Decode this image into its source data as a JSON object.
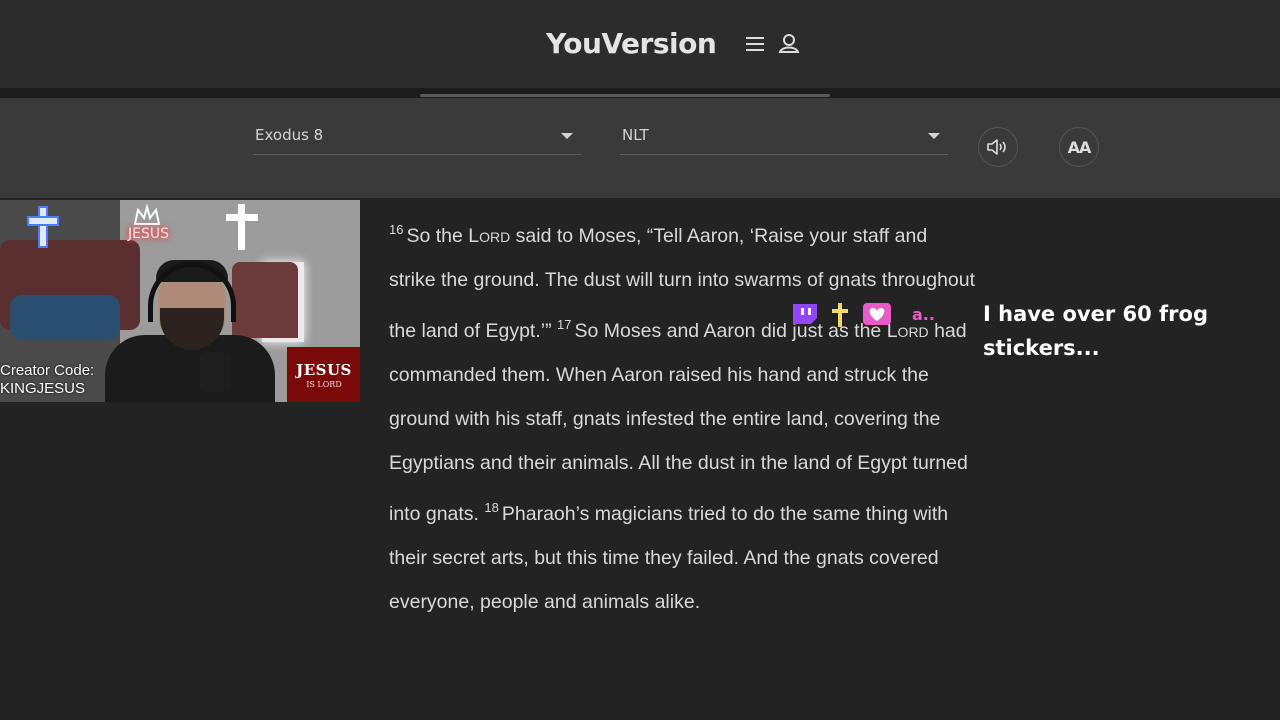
{
  "header": {
    "logo": "YouVersion",
    "menu_icon": "hamburger-menu-icon",
    "user_icon": "user-profile-icon"
  },
  "toolbar": {
    "book_select": "Exodus 8",
    "version_select": "NLT",
    "audio_icon": "speaker-audio-icon",
    "font_button": "AA"
  },
  "webcam": {
    "creator_code_line1": "Creator Code:",
    "creator_code_line2": "KINGJESUS",
    "badge_big": "JESUS",
    "badge_small": "IS LORD",
    "neon_sign": "JESUS"
  },
  "passage": {
    "v16_num": "16",
    "v16_a": "So the ",
    "lord1": "Lord",
    "v16_b": " said to Moses, “Tell Aaron, ‘Raise your staff and strike the ground. The dust will turn into swarms of gnats throughout the land of Egypt.’” ",
    "v17_num": "17",
    "v17_a": "So Moses and Aaron did just as the ",
    "lord2": "Lord",
    "v17_b": " had commanded them. When Aaron raised his hand and struck the ground with his staff, gnats infested the entire land, covering the Egyptians and their animals. All the dust in the land of Egypt turned into gnats. ",
    "v18_num": "18",
    "v18_a": "Pharaoh’s magicians tried to do the same thing with their secret arts, but this time they failed. And the gnats covered everyone, people and animals alike."
  },
  "chat_overlay": {
    "message": "I have over 60 frog stickers...",
    "emote_suffix": "a..",
    "emotes": [
      "twitch-chat-icon",
      "cross-icon",
      "heart-icon"
    ]
  },
  "colors": {
    "background": "#232323",
    "header": "#2c2c2c",
    "toolbar": "#3a3a3a",
    "text": "#d9d9d9",
    "badge_red": "#7a0a0a",
    "emote_pink": "#e85cc8"
  }
}
